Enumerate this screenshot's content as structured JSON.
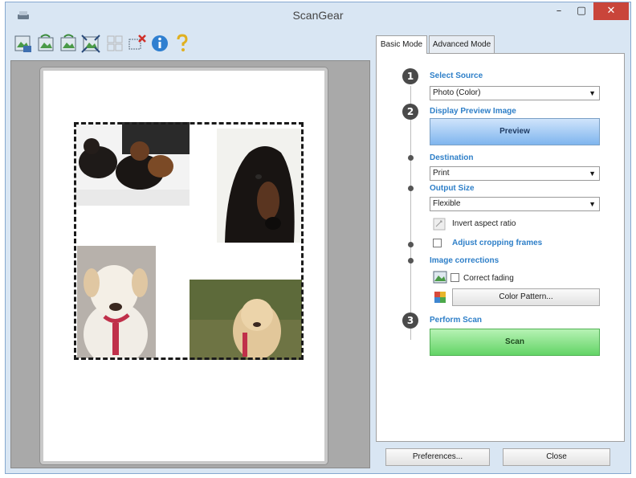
{
  "window": {
    "title": "ScanGear"
  },
  "titlebar": {
    "minimize": "–",
    "maximize": "▢",
    "close": "✕"
  },
  "toolbar": {
    "tools": [
      {
        "icon": "auto-crop-icon"
      },
      {
        "icon": "rotate-left-icon"
      },
      {
        "icon": "rotate-right-icon"
      },
      {
        "icon": "auto-crop-frame-icon"
      },
      {
        "icon": "select-all-frames-icon"
      },
      {
        "icon": "delete-frame-icon"
      },
      {
        "icon": "info-icon"
      },
      {
        "icon": "help-icon"
      }
    ]
  },
  "tabs": {
    "basic": "Basic Mode",
    "advanced": "Advanced Mode"
  },
  "basic": {
    "step1": {
      "number": "1",
      "label": "Select Source",
      "value": "Photo (Color)"
    },
    "step2": {
      "number": "2",
      "label": "Display Preview Image",
      "button": "Preview"
    },
    "destination": {
      "label": "Destination",
      "value": "Print"
    },
    "output_size": {
      "label": "Output Size",
      "value": "Flexible"
    },
    "invert_aspect": {
      "label": "Invert aspect ratio"
    },
    "adjust_crop": {
      "label": "Adjust cropping frames",
      "checked": false
    },
    "image_corrections": {
      "label": "Image corrections"
    },
    "correct_fading": {
      "label": "Correct fading",
      "checked": false
    },
    "color_pattern": {
      "button": "Color Pattern..."
    },
    "step3": {
      "number": "3",
      "label": "Perform Scan",
      "button": "Scan"
    }
  },
  "footer": {
    "preferences": "Preferences...",
    "close": "Close"
  },
  "colors": {
    "accent": "#2e7fc8",
    "scan_green": "#63d466",
    "preview_blue": "#7fb5ee",
    "close_red": "#c9453a"
  }
}
